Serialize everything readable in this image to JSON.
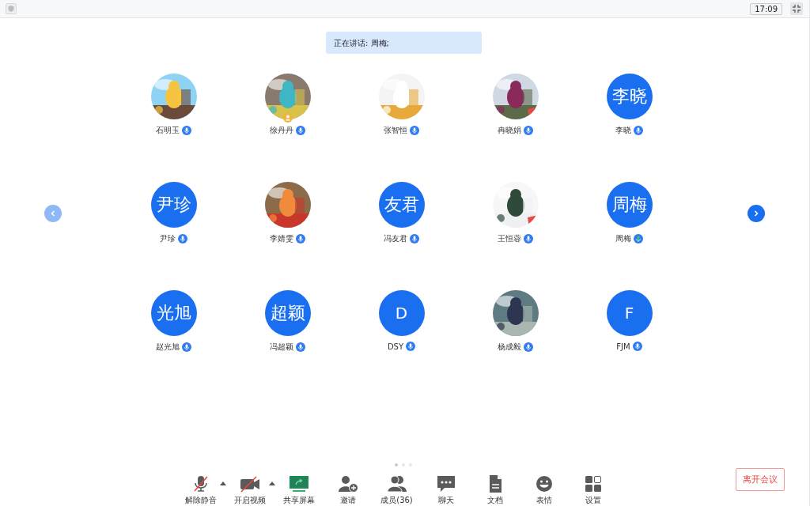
{
  "top_bar": {
    "time": "17:09"
  },
  "speaking_banner": {
    "text": "正在讲话: 周梅;"
  },
  "participants": [
    {
      "name": "石明玉",
      "speaking": false,
      "host": false
    },
    {
      "name": "徐丹丹",
      "speaking": false,
      "host": true
    },
    {
      "name": "张智恒",
      "speaking": false,
      "host": false
    },
    {
      "name": "冉晓娟",
      "speaking": false,
      "host": false
    },
    {
      "name": "李晓",
      "kind": "initials",
      "initials": "李晓",
      "speaking": false,
      "host": false
    },
    {
      "name": "尹珍",
      "kind": "initials",
      "initials": "尹珍",
      "speaking": false,
      "host": false
    },
    {
      "name": "李婧雯",
      "speaking": false,
      "host": false
    },
    {
      "name": "冯友君",
      "kind": "initials",
      "initials": "友君",
      "speaking": false,
      "host": false
    },
    {
      "name": "王恒蓉",
      "speaking": false,
      "host": false
    },
    {
      "name": "周梅",
      "kind": "initials",
      "initials": "周梅",
      "speaking": true,
      "host": false
    },
    {
      "name": "赵光旭",
      "kind": "initials",
      "initials": "光旭",
      "speaking": false,
      "host": false
    },
    {
      "name": "冯超颖",
      "kind": "initials",
      "initials": "超颖",
      "speaking": false,
      "host": false
    },
    {
      "name": "DSY",
      "kind": "initials",
      "initials": "D",
      "speaking": false,
      "host": false
    },
    {
      "name": "杨成毅",
      "speaking": false,
      "host": false
    },
    {
      "name": "FJM",
      "kind": "initials",
      "initials": "F",
      "speaking": false,
      "host": false
    }
  ],
  "page_dots": [
    {
      "selected": true
    },
    {
      "selected": false
    },
    {
      "selected": false
    }
  ],
  "toolbar": [
    {
      "kind": "mic-off",
      "label": "解除静音",
      "caret": true
    },
    {
      "kind": "video-off",
      "label": "开启视频",
      "caret": true
    },
    {
      "kind": "share",
      "label": "共享屏幕",
      "caret": false
    },
    {
      "kind": "invite",
      "label": "邀请",
      "caret": false
    },
    {
      "kind": "members",
      "label": "成员(36)",
      "caret": false
    },
    {
      "kind": "chat",
      "label": "聊天",
      "caret": false
    },
    {
      "kind": "docs",
      "label": "文档",
      "caret": false
    },
    {
      "kind": "emoji",
      "label": "表情",
      "caret": false
    },
    {
      "kind": "settings",
      "label": "设置",
      "caret": false
    }
  ],
  "leave_button": {
    "label": "离开会议"
  }
}
